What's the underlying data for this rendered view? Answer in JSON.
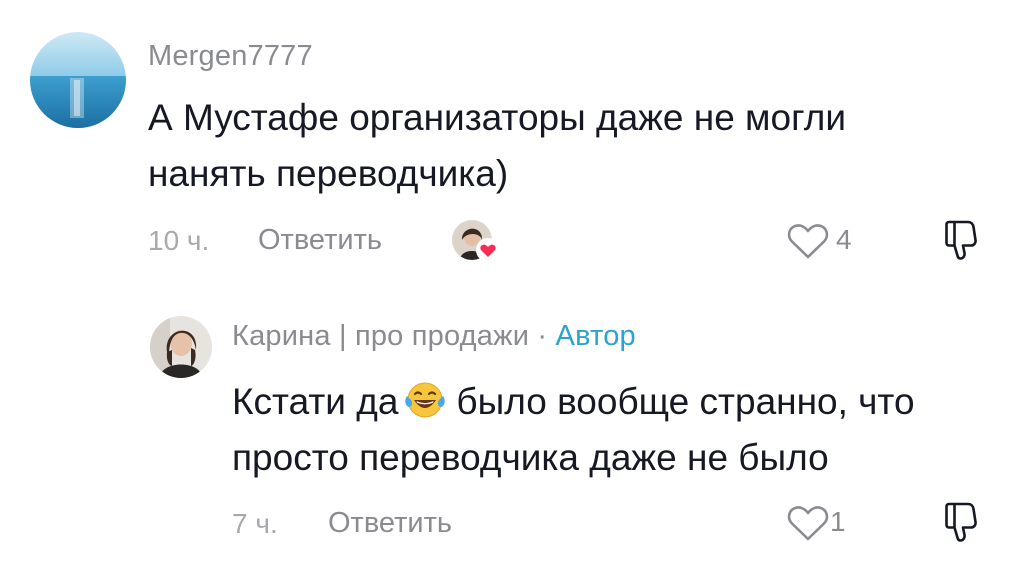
{
  "comments": [
    {
      "username": "Mergen7777",
      "text_lines": [
        "А Мустафе организаторы даже не могли",
        "нанять переводчика)"
      ],
      "time": "10 ч.",
      "reply_label": "Ответить",
      "likes": "4",
      "liked_by_author": true,
      "avatar": "sea-horizon-avatar"
    },
    {
      "username": "Карина | про продажи",
      "separator": "·",
      "badge": "Автор",
      "text_line1_before": "Кстати да",
      "emoji": "face-with-tears-of-joy",
      "text_line1_after": "было вообще странно, что",
      "text_line2": "просто переводчика даже не было",
      "time": "7 ч.",
      "reply_label": "Ответить",
      "likes": "1",
      "avatar": "woman-portrait-avatar"
    }
  ],
  "colors": {
    "text": "#161823",
    "secondary": "#8a8b91",
    "author_badge": "#2aa3cf",
    "heart_badge": "#fe2c55"
  }
}
